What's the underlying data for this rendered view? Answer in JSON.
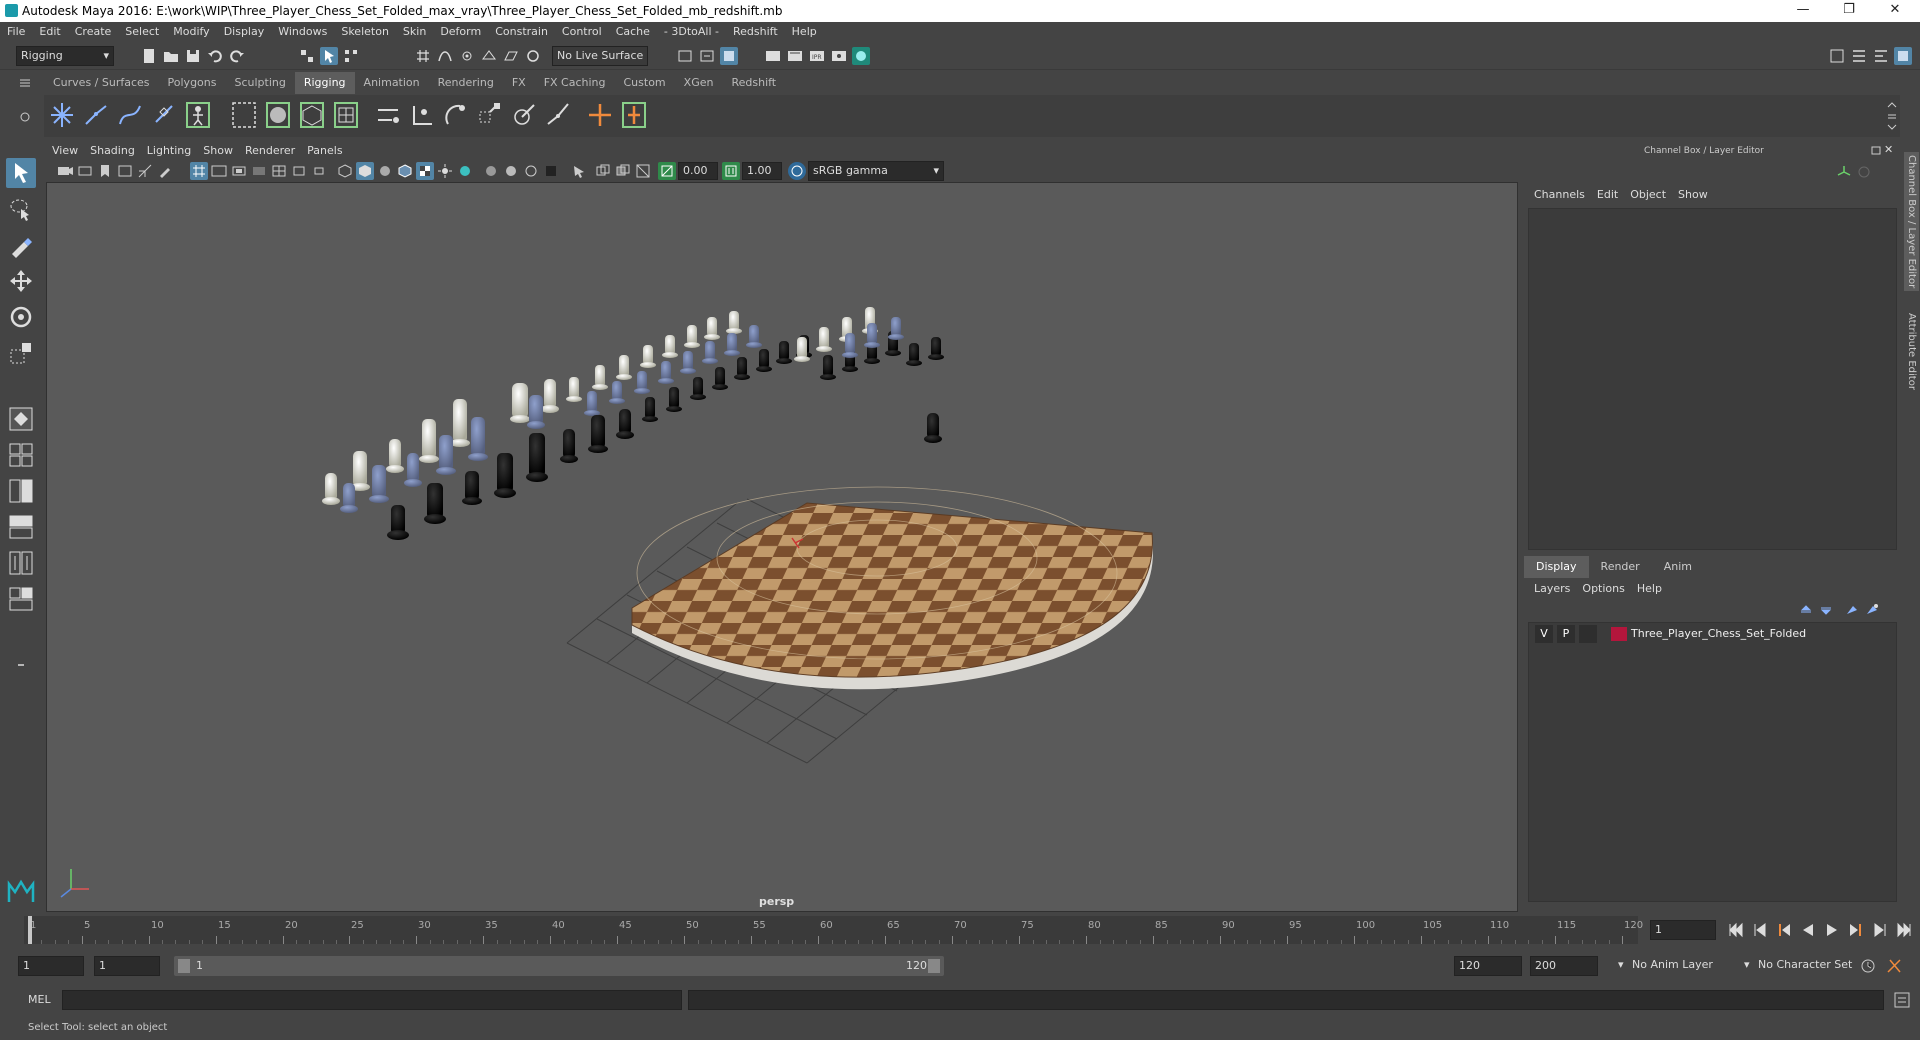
{
  "window": {
    "title": "Autodesk Maya 2016: E:\\work\\WIP\\Three_Player_Chess_Set_Folded_max_vray\\Three_Player_Chess_Set_Folded_mb_redshift.mb",
    "minimize": "—",
    "restore": "❐",
    "close": "✕"
  },
  "menubar": [
    "File",
    "Edit",
    "Create",
    "Select",
    "Modify",
    "Display",
    "Windows",
    "Skeleton",
    "Skin",
    "Deform",
    "Constrain",
    "Control",
    "Cache",
    "- 3DtoAll -",
    "Redshift",
    "Help"
  ],
  "statusline": {
    "menuset": "Rigging",
    "live_surface": "No Live Surface"
  },
  "shelf": {
    "tabs": [
      "Curves / Surfaces",
      "Polygons",
      "Sculpting",
      "Rigging",
      "Animation",
      "Rendering",
      "FX",
      "FX Caching",
      "Custom",
      "XGen",
      "Redshift"
    ],
    "active_tab": "Rigging"
  },
  "viewport": {
    "menu": [
      "View",
      "Shading",
      "Lighting",
      "Show",
      "Renderer",
      "Panels"
    ],
    "exposure": "0.00",
    "gamma": "1.00",
    "color_space": "sRGB gamma",
    "camera_label": "persp"
  },
  "channel_box": {
    "title": "Channel Box / Layer Editor",
    "menu": [
      "Channels",
      "Edit",
      "Object",
      "Show"
    ]
  },
  "layer_editor": {
    "tabs": [
      "Display",
      "Render",
      "Anim"
    ],
    "active_tab": "Display",
    "menu": [
      "Layers",
      "Options",
      "Help"
    ],
    "layers": [
      {
        "visible": "V",
        "playback": "P",
        "color": "#b3163c",
        "name": "Three_Player_Chess_Set_Folded"
      }
    ]
  },
  "side_tabs": [
    "Channel Box / Layer Editor",
    "Attribute Editor"
  ],
  "timeline": {
    "ticks": [
      "1",
      "5",
      "10",
      "15",
      "20",
      "25",
      "30",
      "35",
      "40",
      "45",
      "50",
      "55",
      "60",
      "65",
      "70",
      "75",
      "80",
      "85",
      "90",
      "95",
      "100",
      "105",
      "110",
      "115",
      "120"
    ],
    "current_frame": "1"
  },
  "range": {
    "start": "1",
    "playback_start": "1",
    "slider_start": "1",
    "slider_end": "120",
    "playback_end": "120",
    "end": "200",
    "anim_layer": "No Anim Layer",
    "character_set": "No Character Set"
  },
  "command_line": {
    "label": "MEL"
  },
  "help_line": {
    "text": "Select Tool: select an object"
  }
}
